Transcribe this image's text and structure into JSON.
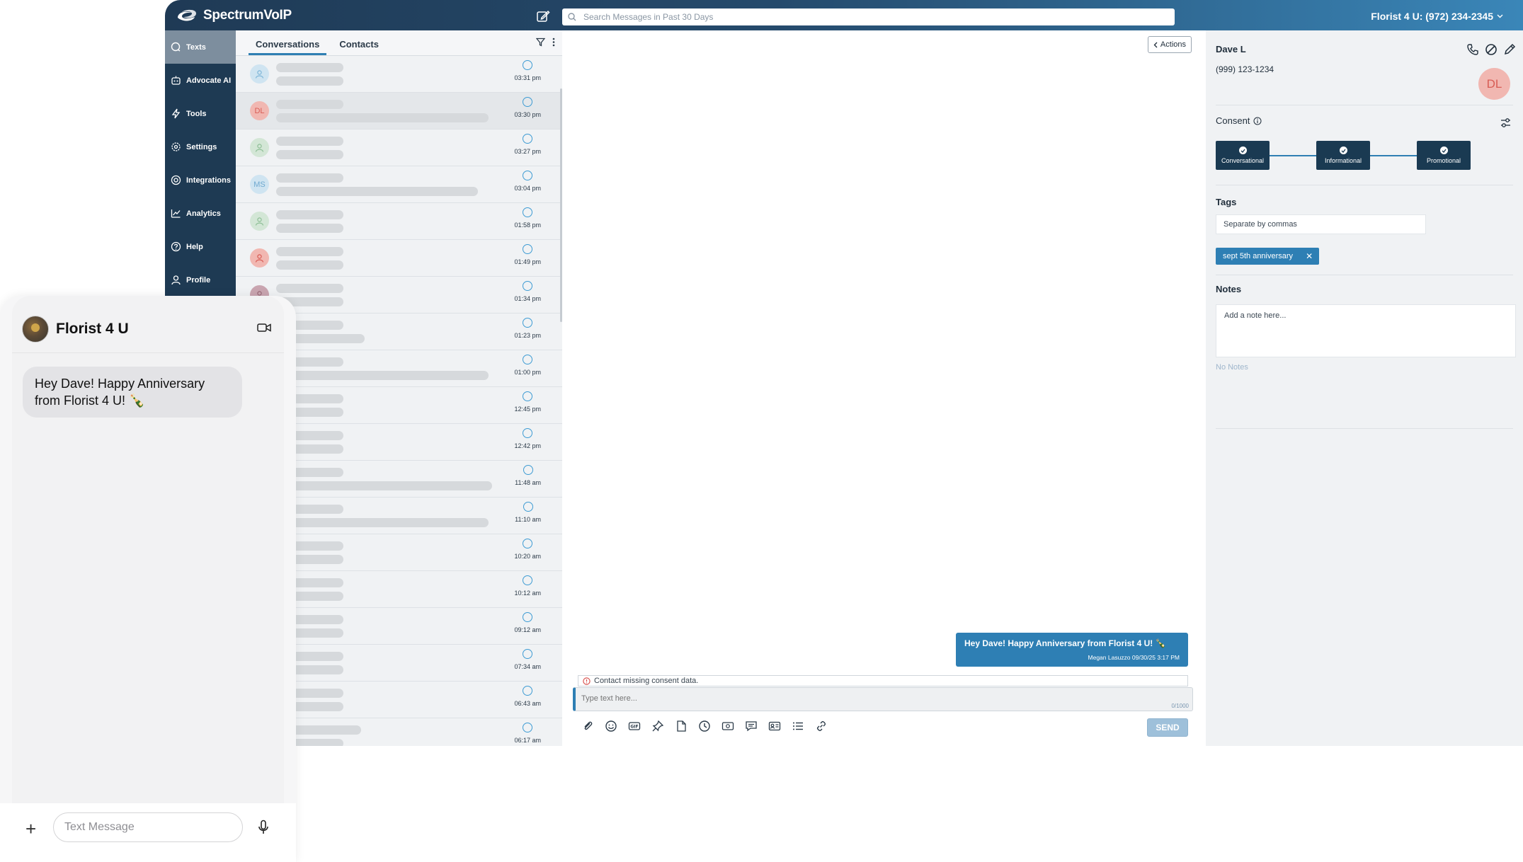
{
  "app": {
    "brand": "SpectrumVoIP",
    "search_placeholder": "Search Messages in Past 30 Days",
    "account": "Florist 4 U: (972) 234-2345"
  },
  "nav": {
    "items": [
      {
        "label": "Texts",
        "icon": "message-icon",
        "active": true
      },
      {
        "label": "Advocate AI",
        "icon": "robot-icon"
      },
      {
        "label": "Tools",
        "icon": "tools-icon"
      },
      {
        "label": "Settings",
        "icon": "gear-icon"
      },
      {
        "label": "Integrations",
        "icon": "integrations-icon"
      },
      {
        "label": "Analytics",
        "icon": "chart-icon"
      },
      {
        "label": "Help",
        "icon": "help-icon"
      },
      {
        "label": "Profile",
        "icon": "user-icon"
      }
    ]
  },
  "conversations": {
    "tabs": [
      "Conversations",
      "Contacts"
    ],
    "rows": [
      {
        "time": "03:31 pm",
        "initials": "",
        "avatar_bg": "#cfe4f1",
        "avatar_fg": "#7fb6d8"
      },
      {
        "time": "03:30 pm",
        "initials": "DL",
        "avatar_bg": "#f1b7b1",
        "avatar_fg": "#d85d55"
      },
      {
        "time": "03:27 pm",
        "initials": "",
        "avatar_bg": "#d3e6d6",
        "avatar_fg": "#8fbf97"
      },
      {
        "time": "03:04 pm",
        "initials": "MS",
        "avatar_bg": "#cfe4f1",
        "avatar_fg": "#6fa9d0"
      },
      {
        "time": "01:58 pm",
        "initials": "",
        "avatar_bg": "#d3e6d6",
        "avatar_fg": "#8fbf97"
      },
      {
        "time": "01:49 pm",
        "initials": "",
        "avatar_bg": "#f1b7b1",
        "avatar_fg": "#d85d55"
      },
      {
        "time": "01:34 pm",
        "initials": "",
        "avatar_bg": "#c9a5b0",
        "avatar_fg": "#9a6a78"
      },
      {
        "time": "01:23 pm",
        "initials": "",
        "avatar_bg": "#cfe4f1",
        "avatar_fg": "#7fb6d8"
      },
      {
        "time": "01:00 pm",
        "initials": "",
        "avatar_bg": "#cfe4f1",
        "avatar_fg": "#7fb6d8"
      },
      {
        "time": "12:45 pm",
        "initials": "",
        "avatar_bg": "#cfe4f1",
        "avatar_fg": "#7fb6d8"
      },
      {
        "time": "12:42 pm",
        "initials": "",
        "avatar_bg": "#cfe4f1",
        "avatar_fg": "#7fb6d8"
      },
      {
        "time": "11:48 am",
        "initials": "",
        "avatar_bg": "#cfe4f1",
        "avatar_fg": "#7fb6d8"
      },
      {
        "time": "11:10 am",
        "initials": "",
        "avatar_bg": "#cfe4f1",
        "avatar_fg": "#7fb6d8"
      },
      {
        "time": "10:20 am",
        "initials": "",
        "avatar_bg": "#cfe4f1",
        "avatar_fg": "#7fb6d8"
      },
      {
        "time": "10:12 am",
        "initials": "",
        "avatar_bg": "#cfe4f1",
        "avatar_fg": "#7fb6d8"
      },
      {
        "time": "09:12 am",
        "initials": "",
        "avatar_bg": "#cfe4f1",
        "avatar_fg": "#7fb6d8"
      },
      {
        "time": "07:34 am",
        "initials": "",
        "avatar_bg": "#cfe4f1",
        "avatar_fg": "#7fb6d8"
      },
      {
        "time": "06:43 am",
        "initials": "",
        "avatar_bg": "#cfe4f1",
        "avatar_fg": "#7fb6d8"
      },
      {
        "time": "06:17 am",
        "initials": "",
        "avatar_bg": "#cfe4f1",
        "avatar_fg": "#7fb6d8"
      }
    ]
  },
  "pane": {
    "actions_label": "Actions",
    "message_text": "Hey Dave! Happy Anniversary from Florist 4 U! 🍾",
    "message_meta": "Megan Lasuzzo 09/30/25 3:17 PM",
    "consent_warning": "Contact missing consent data.",
    "composer_placeholder": "Type text here...",
    "counter": "0/1000",
    "send_label": "SEND"
  },
  "contact": {
    "name": "Dave L",
    "phone": "(999) 123-1234",
    "initials": "DL",
    "consent_label": "Consent",
    "consent": [
      "Conversational",
      "Informational",
      "Promotional"
    ],
    "tags_label": "Tags",
    "tags_placeholder": "Separate by commas",
    "tag": "sept 5th anniversary",
    "notes_label": "Notes",
    "notes_placeholder": "Add a note here...",
    "no_notes": "No Notes"
  },
  "phone": {
    "title": "Florist 4 U",
    "message": "Hey Dave! Happy Anniversary from Florist 4 U! 🍾",
    "input_placeholder": "Text Message"
  },
  "colors": {
    "accent": "#2e7fb4",
    "nav_bg": "#1e3a53",
    "consent_box": "#1a3a52"
  }
}
